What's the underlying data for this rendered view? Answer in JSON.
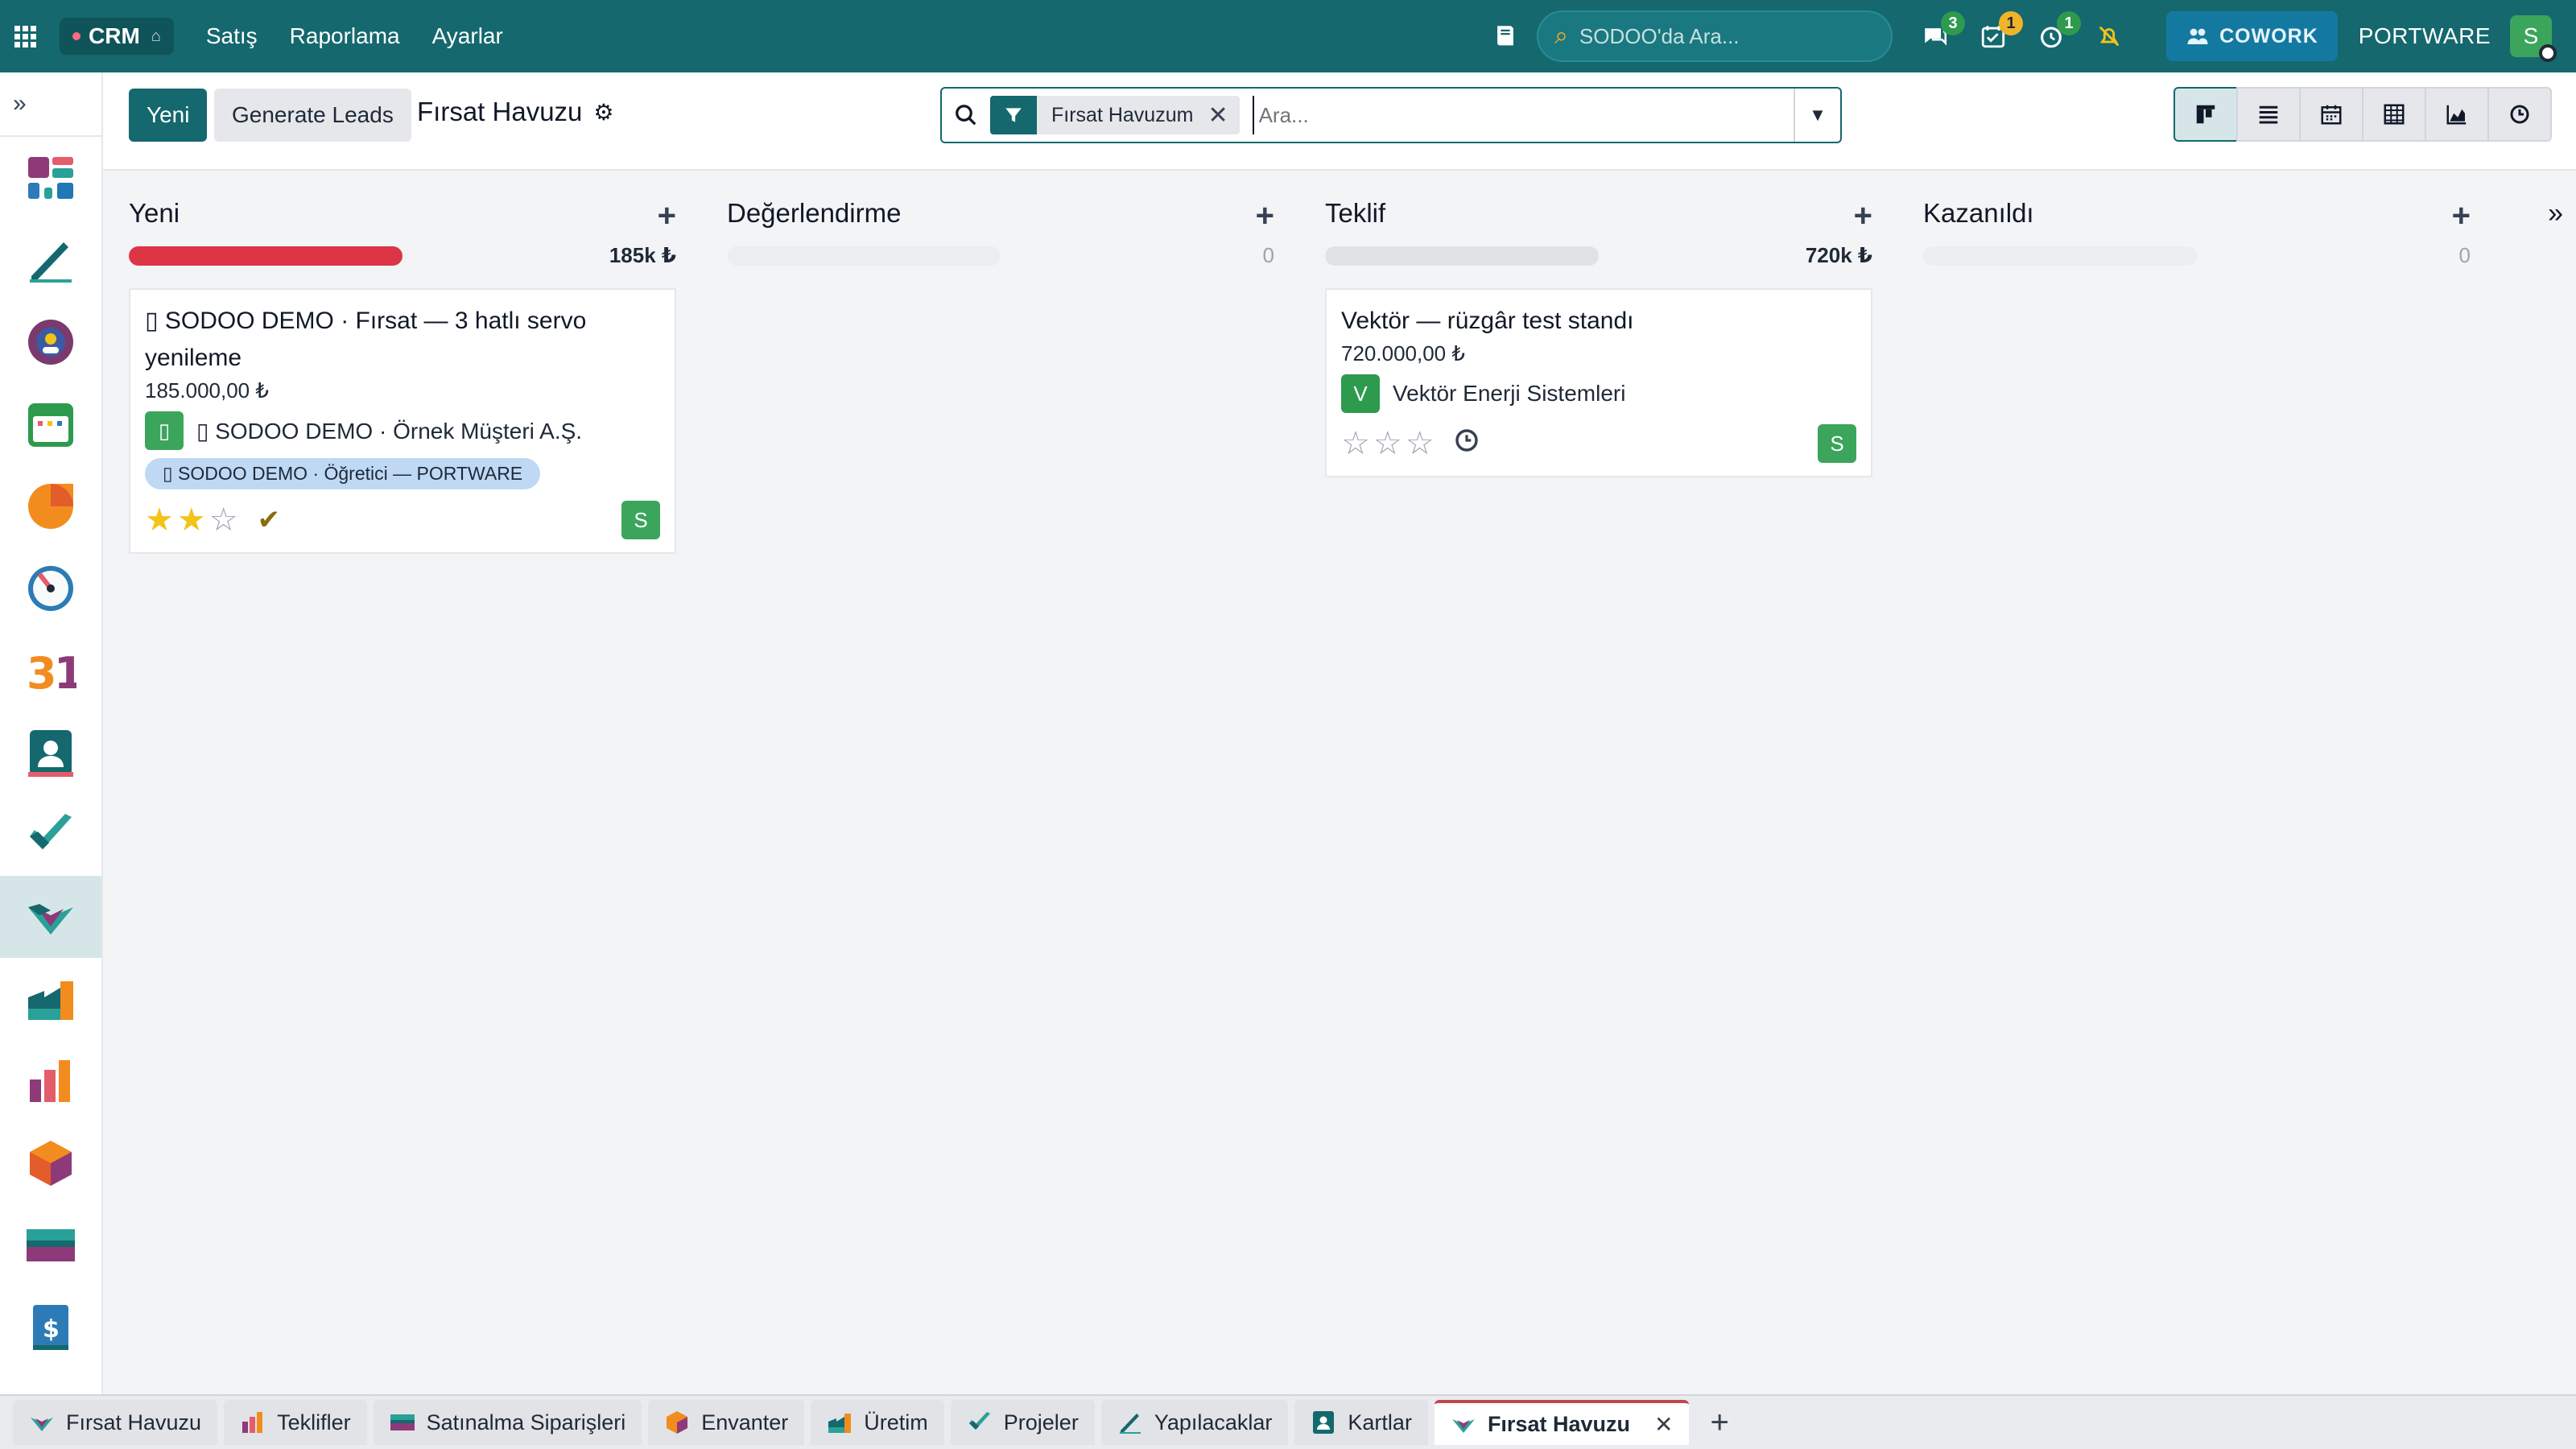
{
  "topnav": {
    "app_name": "CRM",
    "menu": [
      "Satış",
      "Raporlama",
      "Ayarlar"
    ],
    "search_placeholder": "SODOO'da Ara...",
    "badges": {
      "messages": "3",
      "activities": "1",
      "timer": "1"
    },
    "cowork_label": "COWORK",
    "company": "PORTWARE",
    "user_initial": "S"
  },
  "control_panel": {
    "new_label": "Yeni",
    "generate_label": "Generate Leads",
    "title": "Fırsat Havuzu",
    "facet_label": "Fırsat Havuzum",
    "search_placeholder": "Ara..."
  },
  "kanban": {
    "columns": [
      {
        "title": "Yeni",
        "total": "185k ₺",
        "card": {
          "title": "▯ SODOO DEMO · Fırsat — 3 hatlı servo yenileme",
          "amount": "185.000,00 ₺",
          "partner_initial": "▯",
          "partner": "▯ SODOO DEMO · Örnek Müşteri A.Ş.",
          "tag": "▯ SODOO DEMO · Öğretici — PORTWARE",
          "rating": 2,
          "owner": "S"
        }
      },
      {
        "title": "Değerlendirme",
        "total": "0"
      },
      {
        "title": "Teklif",
        "total": "720k ₺",
        "card": {
          "title": "Vektör — rüzgâr test standı",
          "amount": "720.000,00 ₺",
          "partner_initial": "V",
          "partner": "Vektör Enerji Sistemleri",
          "rating": 0,
          "owner": "S"
        }
      },
      {
        "title": "Kazanıldı",
        "total": "0"
      }
    ]
  },
  "tabs": [
    {
      "label": "Fırsat Havuzu",
      "icon": "crm-icon"
    },
    {
      "label": "Teklifler",
      "icon": "sales-icon"
    },
    {
      "label": "Satınalma Siparişleri",
      "icon": "purchase-icon"
    },
    {
      "label": "Envanter",
      "icon": "inventory-icon"
    },
    {
      "label": "Üretim",
      "icon": "manufacturing-icon"
    },
    {
      "label": "Projeler",
      "icon": "project-icon"
    },
    {
      "label": "Yapılacaklar",
      "icon": "todo-icon"
    },
    {
      "label": "Kartlar",
      "icon": "contacts-icon"
    },
    {
      "label": "Fırsat Havuzu",
      "icon": "crm-icon",
      "active": true
    }
  ],
  "colors": {
    "primary": "#14686e",
    "danger_bar": "#dc3545",
    "star": "#f3c316",
    "avatar_green": "#3ba55c",
    "tag_blue": "#bfd9f5"
  }
}
